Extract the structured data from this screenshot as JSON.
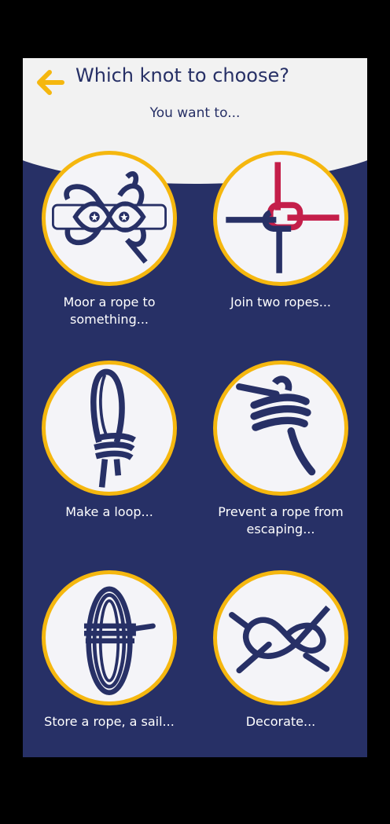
{
  "header": {
    "title": "Which knot to choose?",
    "subtitle": "You want to...",
    "back_icon": "arrow-left-icon",
    "accent": "#f5b70f"
  },
  "colors": {
    "navy": "#273066",
    "gold": "#f5b70f",
    "red": "#c41e4a",
    "header_bg": "#f2f2f2"
  },
  "options": [
    {
      "label_line1": "Moor a rope to",
      "label_line2": "something...",
      "icon": "mooring-knot-icon"
    },
    {
      "label_line1": "Join two ropes...",
      "label_line2": "",
      "icon": "join-ropes-knot-icon"
    },
    {
      "label_line1": "Make a loop...",
      "label_line2": "",
      "icon": "loop-knot-icon"
    },
    {
      "label_line1": "Prevent a rope from",
      "label_line2": "escaping...",
      "icon": "stopper-knot-icon"
    },
    {
      "label_line1": "Store a rope, a sail...",
      "label_line2": "",
      "icon": "coiled-rope-icon"
    },
    {
      "label_line1": "Decorate...",
      "label_line2": "",
      "icon": "decorative-knot-icon"
    }
  ]
}
